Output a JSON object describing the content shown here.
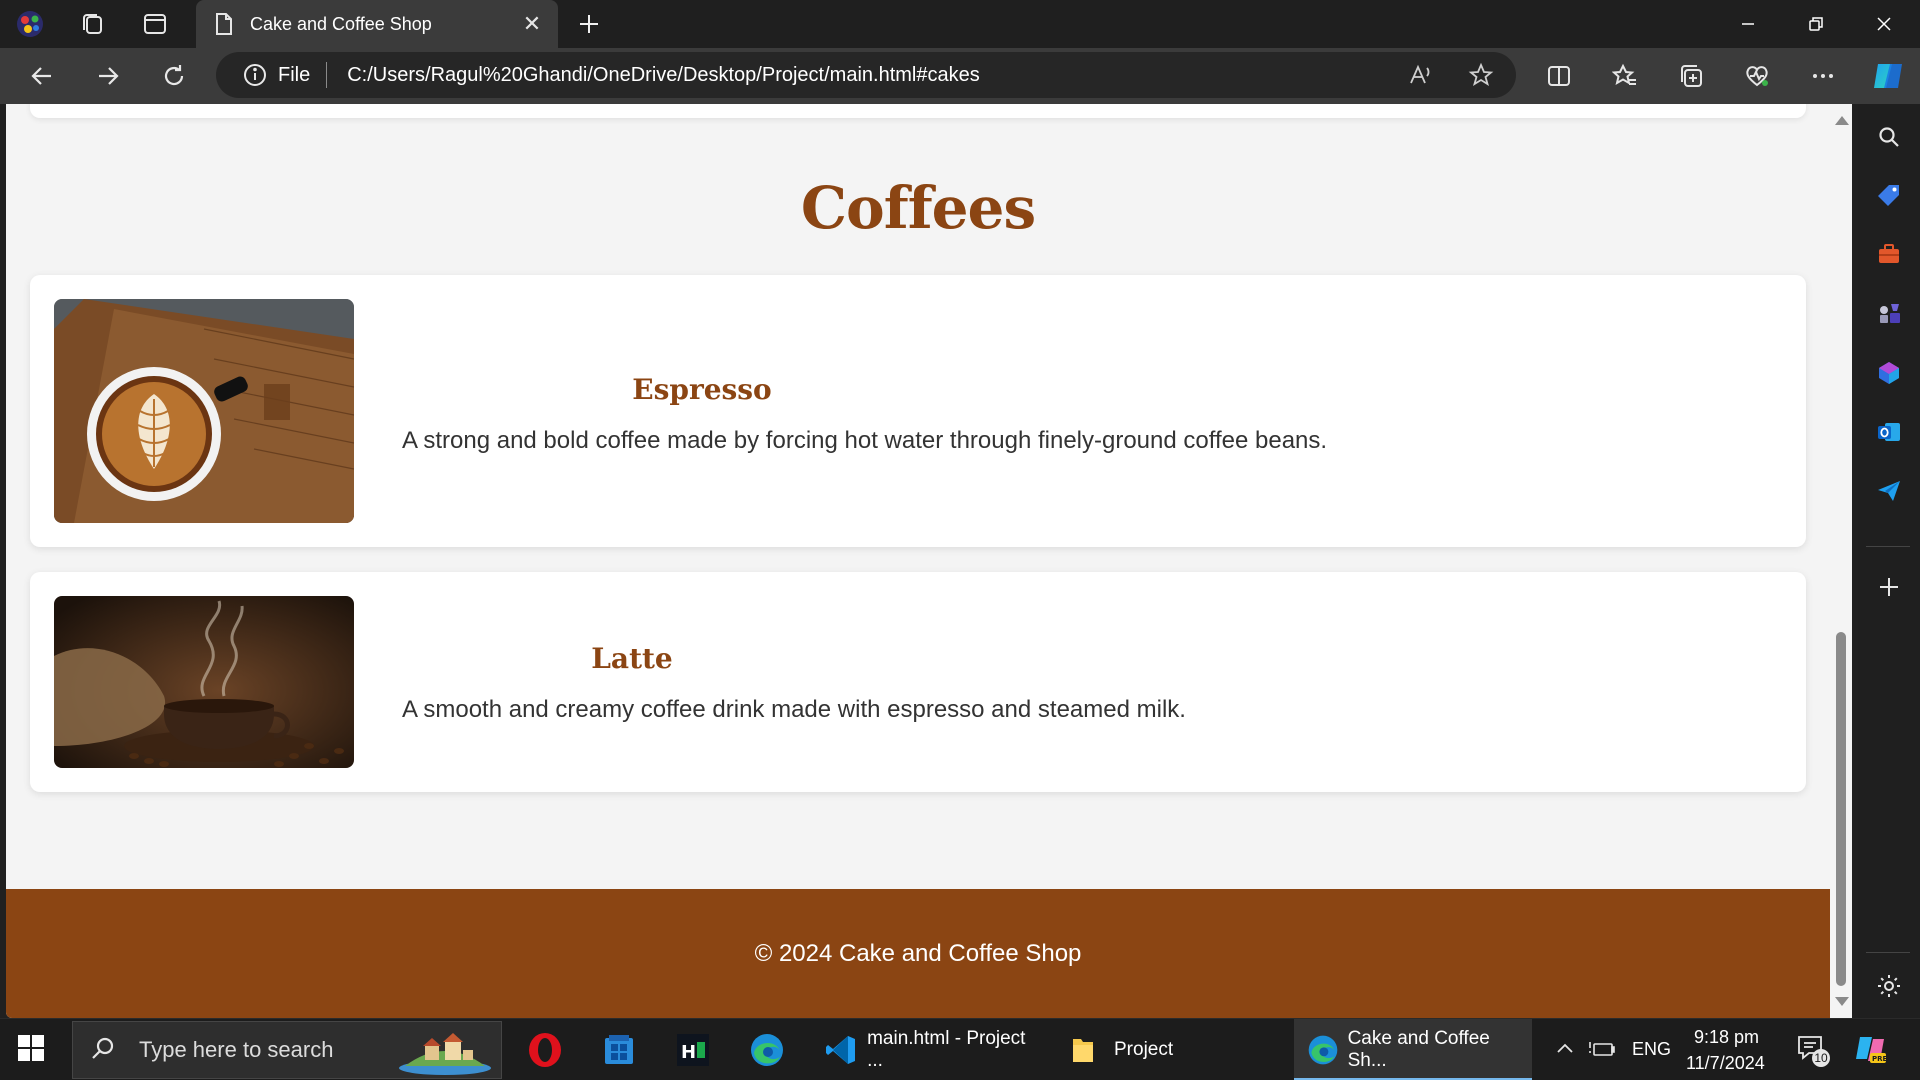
{
  "browser": {
    "tab_title": "Cake and Coffee Shop",
    "address_protocol": "File",
    "url": "C:/Users/Ragul%20Ghandi/OneDrive/Desktop/Project/main.html#cakes"
  },
  "page": {
    "section_title": "Coffees",
    "items": [
      {
        "name": "Espresso",
        "description": "A strong and bold coffee made by forcing hot water through finely-ground coffee beans."
      },
      {
        "name": "Latte",
        "description": "A smooth and creamy coffee drink made with espresso and steamed milk."
      }
    ],
    "footer": "© 2024 Cake and Coffee Shop"
  },
  "taskbar": {
    "search_placeholder": "Type here to search",
    "apps": [
      {
        "label": "main.html - Project ..."
      },
      {
        "label": "Project"
      },
      {
        "label": "Cake and Coffee Sh..."
      }
    ],
    "tray": {
      "language": "ENG",
      "time": "9:18 pm",
      "date": "11/7/2024",
      "notification_count": "10"
    }
  },
  "colors": {
    "brand_brown": "#8b4513",
    "page_bg": "#f4f4f4",
    "browser_chrome": "#3b3b3b"
  }
}
